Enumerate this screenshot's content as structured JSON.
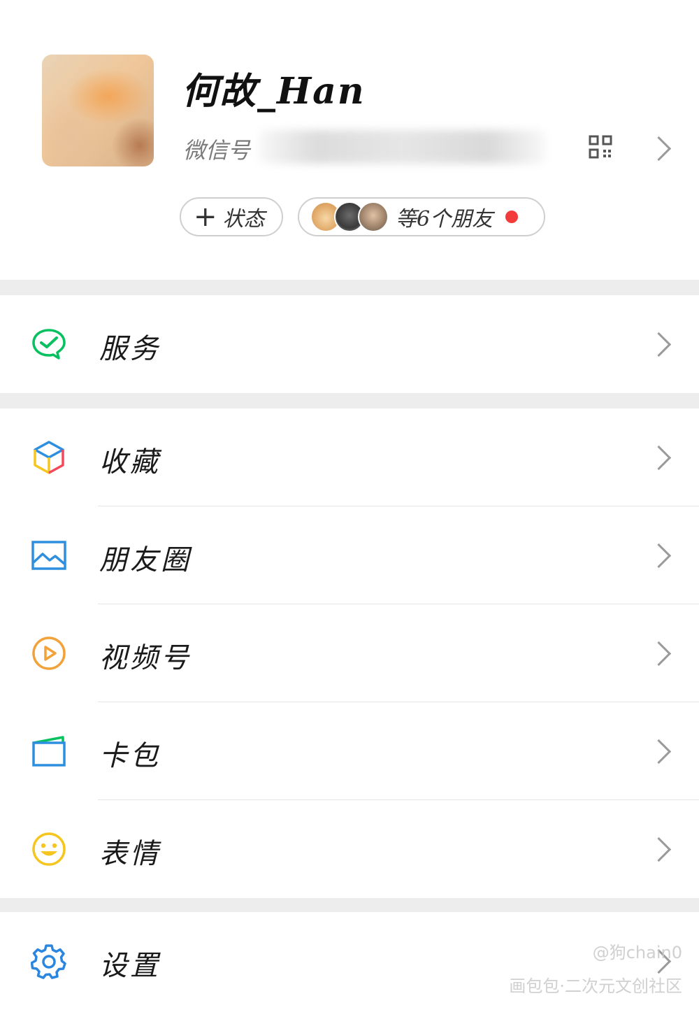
{
  "profile": {
    "nickname": "何故_Han",
    "wechat_id_label": "微信号",
    "status_button": {
      "plus": "+",
      "label": "状态"
    },
    "friends_status": {
      "label": "等6个朋友"
    }
  },
  "menu": {
    "services": "服务",
    "favorites": "收藏",
    "moments": "朋友圈",
    "channels": "视频号",
    "cards": "卡包",
    "stickers": "表情",
    "settings": "设置"
  },
  "watermark": {
    "line1": "@狗chain0",
    "line2": "画包包·二次元文创社区"
  },
  "colors": {
    "services_green": "#07c160",
    "moments_blue": "#2f8fdf",
    "channels_orange": "#f2a23a",
    "stickers_yellow": "#f6c520",
    "settings_blue": "#2b86e0",
    "red_dot": "#f23c3c",
    "separator_gray": "#ededed"
  },
  "icons": {
    "qr": "qr-code-icon",
    "services": "wechat-pay-check-icon",
    "favorites": "cube-icon",
    "moments": "image-icon",
    "channels": "play-circle-icon",
    "cards": "wallet-icon",
    "stickers": "smiley-icon",
    "settings": "gear-icon"
  }
}
